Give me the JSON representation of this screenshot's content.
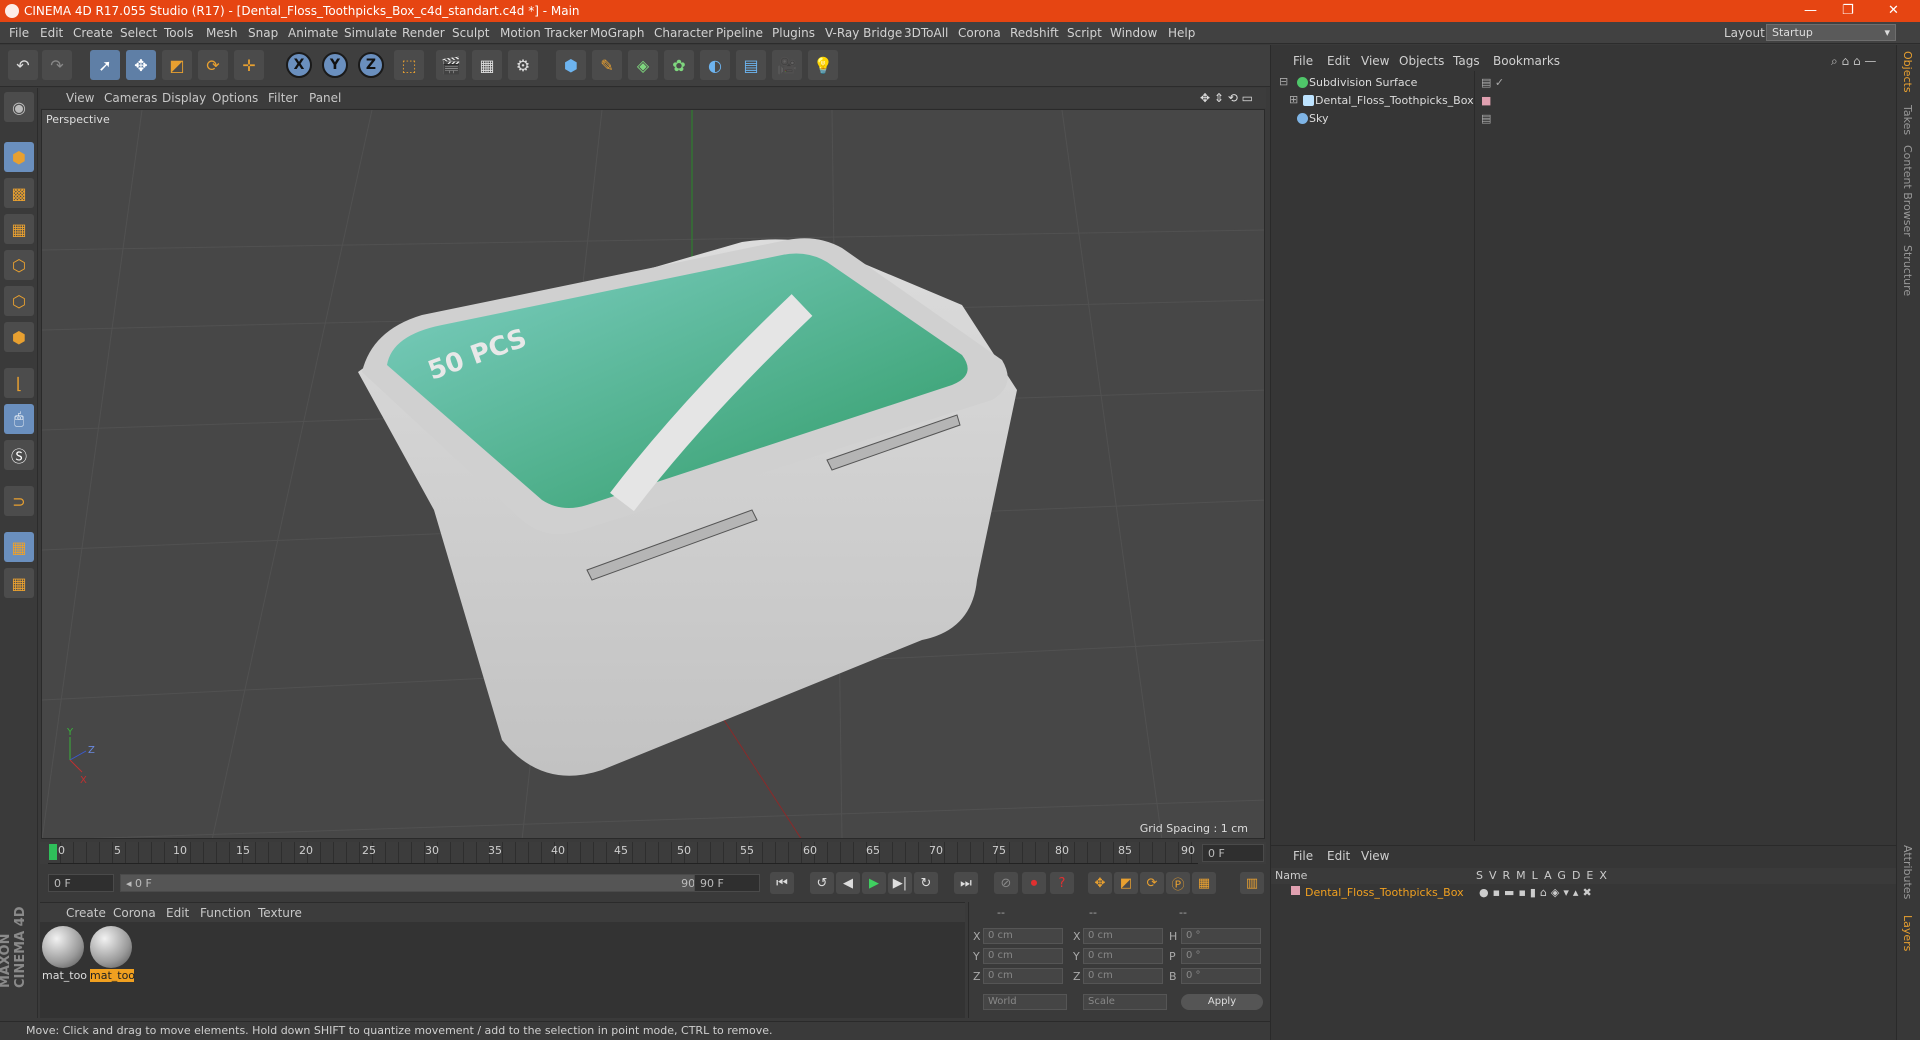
{
  "window": {
    "title": "CINEMA 4D R17.055 Studio (R17) - [Dental_Floss_Toothpicks_Box_c4d_standart.c4d *] - Main",
    "minimize": "—",
    "restore": "❐",
    "close": "✕"
  },
  "menu": {
    "items": [
      "File",
      "Edit",
      "Create",
      "Select",
      "Tools",
      "Mesh",
      "Snap",
      "Animate",
      "Simulate",
      "Render",
      "Sculpt",
      "Motion Tracker",
      "MoGraph",
      "Character",
      "Pipeline",
      "Plugins",
      "V-Ray Bridge",
      "3DToAll",
      "Corona",
      "Redshift",
      "Script",
      "Window",
      "Help"
    ],
    "layout_label": "Layout:",
    "layout_value": "Startup"
  },
  "toolbar": {
    "icons": [
      "undo-icon",
      "redo-icon",
      "select-arrow-icon",
      "move-icon",
      "scale-icon",
      "rotate-icon",
      "move-alt-icon",
      "axis-x-icon",
      "axis-y-icon",
      "axis-z-icon",
      "coordinate-system-icon",
      "render-view-icon",
      "render-picture-viewer-icon",
      "edit-render-settings-icon",
      "cube-primitive-icon",
      "pen-spline-icon",
      "subdivision-icon",
      "mograph-cloner-icon",
      "deformer-icon",
      "floor-icon",
      "camera-icon",
      "light-icon"
    ],
    "axis_labels": {
      "x": "X",
      "y": "Y",
      "z": "Z"
    }
  },
  "viewport": {
    "menu": [
      "View",
      "Cameras",
      "Display",
      "Options",
      "Filter",
      "Panel"
    ],
    "label": "Perspective",
    "grid_spacing": "Grid Spacing : 1 cm",
    "axis_y": "Y",
    "axis_z": "Z",
    "axis_x": "X",
    "box_text": "50 PCS"
  },
  "timeline": {
    "ticks": [
      "0",
      "5",
      "10",
      "15",
      "20",
      "25",
      "30",
      "35",
      "40",
      "45",
      "50",
      "55",
      "60",
      "65",
      "70",
      "75",
      "80",
      "85",
      "90"
    ],
    "frame_field": "0 F",
    "start_field": "0 F",
    "range_start": "◂ 0 F",
    "range_end": "90 F ▸",
    "end_field": "90 F"
  },
  "materials": {
    "menu": [
      "Create",
      "Corona",
      "Edit",
      "Function",
      "Texture"
    ],
    "items": [
      {
        "name": "mat_too",
        "selected": false
      },
      {
        "name": "mat_too",
        "selected": true
      }
    ]
  },
  "coords": {
    "headers": [
      "--",
      "--",
      "--"
    ],
    "rows": [
      {
        "a": "X",
        "av": "0 cm",
        "b": "X",
        "bv": "0 cm",
        "c": "H",
        "cv": "0 °"
      },
      {
        "a": "Y",
        "av": "0 cm",
        "b": "Y",
        "bv": "0 cm",
        "c": "P",
        "cv": "0 °"
      },
      {
        "a": "Z",
        "av": "0 cm",
        "b": "Z",
        "bv": "0 cm",
        "c": "B",
        "cv": "0 °"
      }
    ],
    "world": "World",
    "scale": "Scale",
    "apply": "Apply"
  },
  "objects": {
    "menu": [
      "File",
      "Edit",
      "View",
      "Objects",
      "Tags",
      "Bookmarks"
    ],
    "rows": [
      {
        "name": "Subdivision Surface",
        "color": "#4fc76a"
      },
      {
        "name": "Dental_Floss_Toothpicks_Box",
        "color": "#bde3ff"
      },
      {
        "name": "Sky",
        "color": "#7fb5e6"
      }
    ]
  },
  "layers": {
    "menu": [
      "File",
      "Edit",
      "View"
    ],
    "header_name": "Name",
    "header_cols": [
      "S",
      "V",
      "R",
      "M",
      "L",
      "A",
      "G",
      "D",
      "E",
      "X"
    ],
    "row_name": "Dental_Floss_Toothpicks_Box"
  },
  "side_tabs": [
    "Objects",
    "Takes",
    "Content Browser",
    "Structure",
    "Attributes",
    "Layers"
  ],
  "status": "Move: Click and drag to move elements. Hold down SHIFT to quantize movement / add to the selection in point mode, CTRL to remove.",
  "brand": "MAXON CINEMA 4D",
  "colors": {
    "title_bar": "#e64512",
    "accent": "#f0a020",
    "box_green": "#3fae7a"
  }
}
